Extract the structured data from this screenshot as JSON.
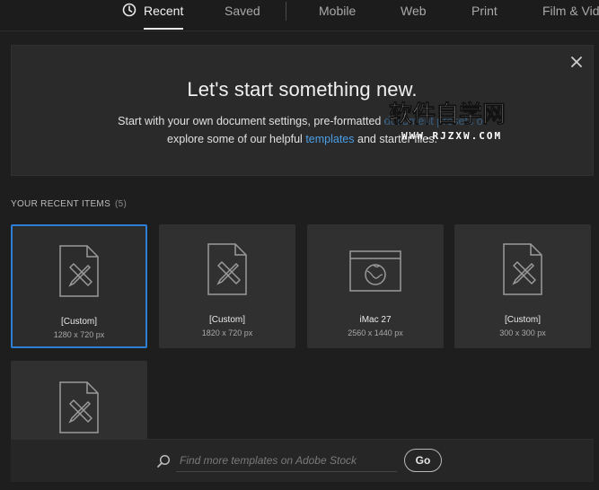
{
  "tabs": [
    {
      "label": "Recent",
      "active": true
    },
    {
      "label": "Saved"
    },
    {
      "label": "Mobile"
    },
    {
      "label": "Web"
    },
    {
      "label": "Print"
    },
    {
      "label": "Film & Vide"
    }
  ],
  "hero": {
    "title": "Let's start something new.",
    "line1_pre": "Start with your own document settings, pre-formatted",
    "line1_obscured": "document presets or",
    "line2_pre": "explore some of our helpful",
    "line2_link": "templates",
    "line2_post": "and starter files."
  },
  "watermark": {
    "text": "软件自学网",
    "url": "WWW.RJZXW.COM"
  },
  "recent": {
    "title": "YOUR RECENT ITEMS",
    "count": "(5)",
    "items": [
      {
        "name": "[Custom]",
        "size": "1280 x 720 px",
        "icon": "document-icon",
        "selected": true
      },
      {
        "name": "[Custom]",
        "size": "1820 x 720 px",
        "icon": "document-icon"
      },
      {
        "name": "iMac 27",
        "size": "2560 x 1440 px",
        "icon": "web-browser-icon"
      },
      {
        "name": "[Custom]",
        "size": "300 x 300 px",
        "icon": "document-icon"
      },
      {
        "name": "",
        "size": "",
        "icon": "document-icon"
      }
    ]
  },
  "search": {
    "placeholder": "Find more templates on Adobe Stock",
    "go_label": "Go"
  },
  "colors": {
    "background": "#1e1e1e",
    "panel": "#2a2a2a",
    "card": "#303030",
    "accent": "#2d7fd6",
    "link": "#4a9fe8"
  }
}
